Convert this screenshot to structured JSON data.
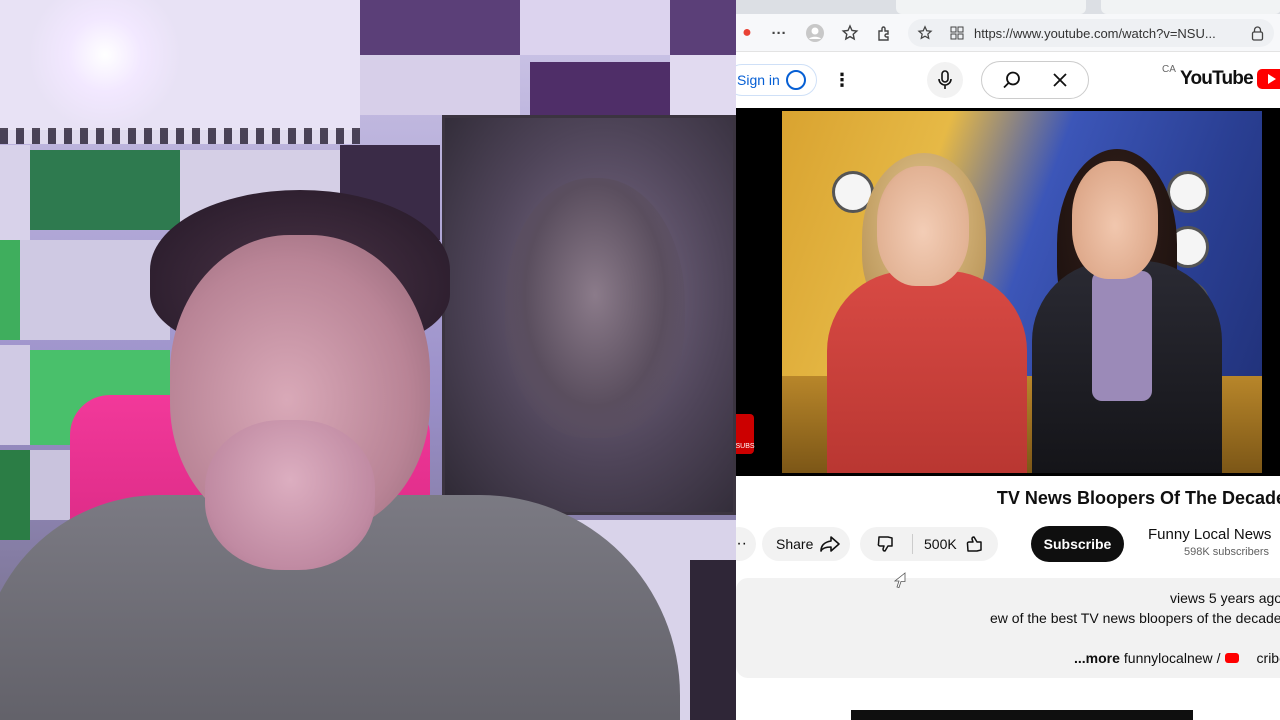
{
  "browser": {
    "address_url": "https://www.youtube.com/watch?v=NSU...",
    "toolbar_more": "···"
  },
  "youtube": {
    "logo_text": "YouTube",
    "country_code": "CA",
    "sign_in_label": "Sign in",
    "video": {
      "title": "TV News Bloopers Of The Decade",
      "channel_name": "Funny Local News",
      "subscribers": "598K subscribers",
      "subscribe_label": "Subscribe",
      "likes": "500K",
      "share_label": "Share",
      "more_actions": "···",
      "views_meta": "views  5 years ago",
      "description": "ew of the best TV news bloopers of the decade.",
      "desc_prefix": "cribe:",
      "desc_sep": "/",
      "desc_handle": "funnylocalnew",
      "desc_more": "...more",
      "sub_badge": "SUBS"
    }
  },
  "colors": {
    "brand_red": "#ff0000",
    "subscribe_bg": "#0f0f0f",
    "signin_blue": "#065fd4"
  }
}
